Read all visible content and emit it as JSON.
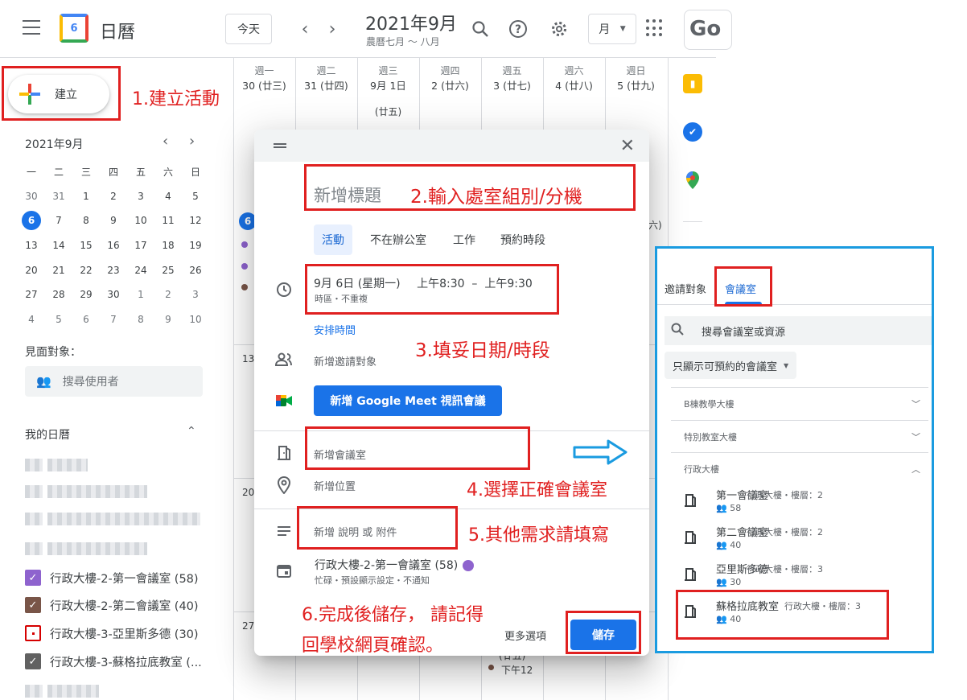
{
  "header": {
    "app_title": "日曆",
    "today_label": "今天",
    "month_title": "2021年9月",
    "lunar_range": "農曆七月 ～ 八月",
    "view_label": "月",
    "google_badge": "Go"
  },
  "sidebar": {
    "create_label": "建立",
    "mini_calendar": {
      "title": "2021年9月",
      "weekdays": [
        "一",
        "二",
        "三",
        "四",
        "五",
        "六",
        "日"
      ],
      "days": [
        "30",
        "31",
        "1",
        "2",
        "3",
        "4",
        "5",
        "6",
        "7",
        "8",
        "9",
        "10",
        "11",
        "12",
        "13",
        "14",
        "15",
        "16",
        "17",
        "18",
        "19",
        "20",
        "21",
        "22",
        "23",
        "24",
        "25",
        "26",
        "27",
        "28",
        "29",
        "30",
        "1",
        "2",
        "3",
        "4",
        "5",
        "6",
        "7",
        "8",
        "9",
        "10"
      ],
      "selected": "6"
    },
    "meet_with_label": "見面對象：",
    "search_users_placeholder": "搜尋使用者",
    "my_calendars_title": "我的日曆",
    "calendars": [
      {
        "label": "行政大樓-2-第一會議室 (58)",
        "color": "#8e63ce",
        "checked": true
      },
      {
        "label": "行政大樓-2-第二會議室 (40)",
        "color": "#795548",
        "checked": true
      },
      {
        "label": "行政大樓-3-亞里斯多德 (30)",
        "color": "#d50000",
        "checked": false
      },
      {
        "label": "行政大樓-3-蘇格拉底教室 (...",
        "color": "#616161",
        "checked": true
      }
    ]
  },
  "week_header": [
    {
      "weekday": "週一",
      "date": "30 (廿三)"
    },
    {
      "weekday": "週二",
      "date": "31 (廿四)"
    },
    {
      "weekday": "週三",
      "date": "9月 1日",
      "extra": "(廿五)"
    },
    {
      "weekday": "週四",
      "date": "2 (廿六)"
    },
    {
      "weekday": "週五",
      "date": "3 (廿七)"
    },
    {
      "weekday": "週六",
      "date": "4 (廿八)"
    },
    {
      "weekday": "週日",
      "date": "5 (廿九)"
    }
  ],
  "calendar_grid": {
    "row_labels": [
      "6",
      "13",
      "20",
      "27"
    ],
    "partial_label": "六)",
    "bottom_event_lunar": "(廿五)",
    "bottom_event_time": "下午12"
  },
  "dialog": {
    "title_placeholder": "新增標題",
    "event_types": [
      "活動",
      "不在辦公室",
      "工作",
      "預約時段"
    ],
    "date_text": "9月 6日 (星期一)",
    "time_text": "上午8:30  –  上午9:30",
    "tz_text": "時區・不重複",
    "find_time_link": "安排時間",
    "add_guests": "新增邀請對象",
    "meet_button": "新增 Google Meet 視訊會議",
    "add_room": "新增會議室",
    "add_location": "新增位置",
    "add_description": "新增 說明 或 附件",
    "calendar_owner": "行政大樓-2-第一會議室 (58)",
    "calendar_sub": "忙碌・預設顯示設定・不通知",
    "more_options": "更多選項",
    "save_button": "儲存"
  },
  "room_panel": {
    "tab_guests": "邀請對象",
    "tab_rooms": "會議室",
    "search_placeholder": "搜尋會議室或資源",
    "filter_label": "只顯示可預約的會議室",
    "groups": [
      "B棟教學大樓",
      "特別教室大樓",
      "行政大樓"
    ],
    "rooms": [
      {
        "name": "第一會議室",
        "meta": "行政大樓・樓層：2",
        "capacity": "58"
      },
      {
        "name": "第二會議室",
        "meta": "行政大樓・樓層：2",
        "capacity": "40"
      },
      {
        "name": "亞里斯多德",
        "meta": "行政大樓・樓層：3",
        "capacity": "30"
      },
      {
        "name": "蘇格拉底教室",
        "meta": "行政大樓・樓層：3",
        "capacity": "40"
      }
    ]
  },
  "annotations": {
    "step1": "1.建立活動",
    "step2": "2.輸入處室組別/分機",
    "step3": "3.填妥日期/時段",
    "step4": "4.選擇正確會議室",
    "step5": "5.其他需求請填寫",
    "step6_line1": "6.完成後儲存， 請記得",
    "step6_line2": "回學校網頁確認。"
  },
  "colors": {
    "accent_blue": "#1a73e8",
    "annotation_red": "#e02020",
    "panel_border": "#1a9be0"
  }
}
